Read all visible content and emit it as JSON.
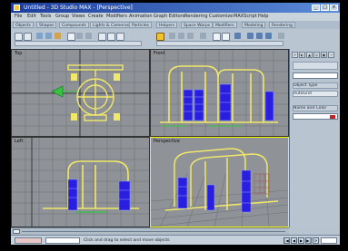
{
  "window": {
    "title": "Untitled - 3D Studio MAX - [Perspective]",
    "minimize_glyph": "_",
    "maximize_glyph": "□",
    "close_glyph": "×"
  },
  "menu": {
    "items": [
      "File",
      "Edit",
      "Tools",
      "Group",
      "Views",
      "Create",
      "Modifiers",
      "Animation",
      "Graph Editors",
      "Rendering",
      "Customize",
      "MAXScript",
      "Help"
    ]
  },
  "toolbar_tabs": {
    "items": [
      "Objects",
      "Shapes",
      "Compounds",
      "Lights & Cameras",
      "Particles",
      "Helpers",
      "Space Warps",
      "Modifiers",
      "Modeling",
      "Rendering"
    ]
  },
  "viewports": {
    "top": {
      "label": "Top"
    },
    "front": {
      "label": "Front"
    },
    "left": {
      "label": "Left"
    },
    "perspective": {
      "label": "Perspective"
    }
  },
  "command_panel": {
    "tabs": [
      "+",
      "◐",
      "▲",
      "◎",
      "▣",
      "✧"
    ],
    "rows": [
      "Object Type",
      "AutoGrid",
      "Name and Color"
    ],
    "swatch_color": "#c3222b"
  },
  "status": {
    "text": "Click and drag to select and move objects",
    "playback_glyphs": [
      "|◀",
      "◀",
      "▶",
      "▶|",
      "⟳"
    ]
  },
  "colors": {
    "wireframe": "#f1e86a",
    "selected": "#2a1fe0",
    "grid": "#6f747c",
    "accent_green": "#36c341"
  }
}
